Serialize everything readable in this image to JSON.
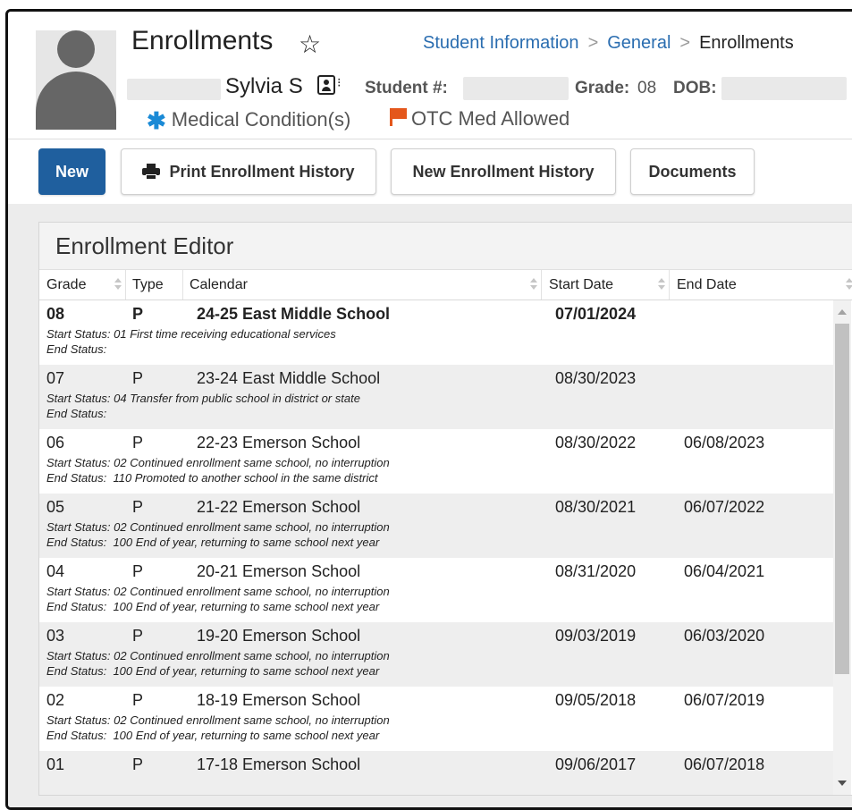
{
  "header": {
    "title": "Enrollments",
    "breadcrumb": [
      "Student Information",
      "General",
      "Enrollments"
    ],
    "student_name": "Sylvia S",
    "student_number_label": "Student #:",
    "grade_label": "Grade:",
    "grade_value": "08",
    "dob_label": "DOB:",
    "medical_label": "Medical Condition(s)",
    "otc_label": "OTC Med Allowed"
  },
  "toolbar": {
    "new_label": "New",
    "print_label": "Print Enrollment History",
    "new_history_label": "New Enrollment History",
    "documents_label": "Documents"
  },
  "editor": {
    "title": "Enrollment Editor",
    "columns": {
      "grade": "Grade",
      "type": "Type",
      "calendar": "Calendar",
      "start_date": "Start Date",
      "end_date": "End Date"
    },
    "start_prefix": "Start Status:",
    "end_prefix": "End Status:",
    "rows": [
      {
        "grade": "08",
        "type": "P",
        "calendar": "24-25 East Middle School",
        "start": "07/01/2024",
        "end": "",
        "start_status": "01 First time receiving educational services",
        "end_status": ""
      },
      {
        "grade": "07",
        "type": "P",
        "calendar": "23-24 East Middle School",
        "start": "08/30/2023",
        "end": "",
        "start_status": "04 Transfer from public school in district or state",
        "end_status": ""
      },
      {
        "grade": "06",
        "type": "P",
        "calendar": "22-23 Emerson School",
        "start": "08/30/2022",
        "end": "06/08/2023",
        "start_status": "02 Continued enrollment same school, no interruption",
        "end_status": "110 Promoted to another school in the same district"
      },
      {
        "grade": "05",
        "type": "P",
        "calendar": "21-22 Emerson School",
        "start": "08/30/2021",
        "end": "06/07/2022",
        "start_status": "02 Continued enrollment same school, no interruption",
        "end_status": "100 End of year, returning to same school next year"
      },
      {
        "grade": "04",
        "type": "P",
        "calendar": "20-21 Emerson School",
        "start": "08/31/2020",
        "end": "06/04/2021",
        "start_status": "02 Continued enrollment same school, no interruption",
        "end_status": "100 End of year, returning to same school next year"
      },
      {
        "grade": "03",
        "type": "P",
        "calendar": "19-20 Emerson School",
        "start": "09/03/2019",
        "end": "06/03/2020",
        "start_status": "02 Continued enrollment same school, no interruption",
        "end_status": "100 End of year, returning to same school next year"
      },
      {
        "grade": "02",
        "type": "P",
        "calendar": "18-19 Emerson School",
        "start": "09/05/2018",
        "end": "06/07/2019",
        "start_status": "02 Continued enrollment same school, no interruption",
        "end_status": "100 End of year, returning to same school next year"
      },
      {
        "grade": "01",
        "type": "P",
        "calendar": "17-18 Emerson School",
        "start": "09/06/2017",
        "end": "06/07/2018",
        "start_status": "",
        "end_status": ""
      }
    ]
  },
  "colors": {
    "primary_button": "#1f5f9e",
    "link": "#2a6db0",
    "medical_icon": "#1a8ad6",
    "otc_flag": "#e4571c",
    "row_alt": "#eeeeee"
  }
}
